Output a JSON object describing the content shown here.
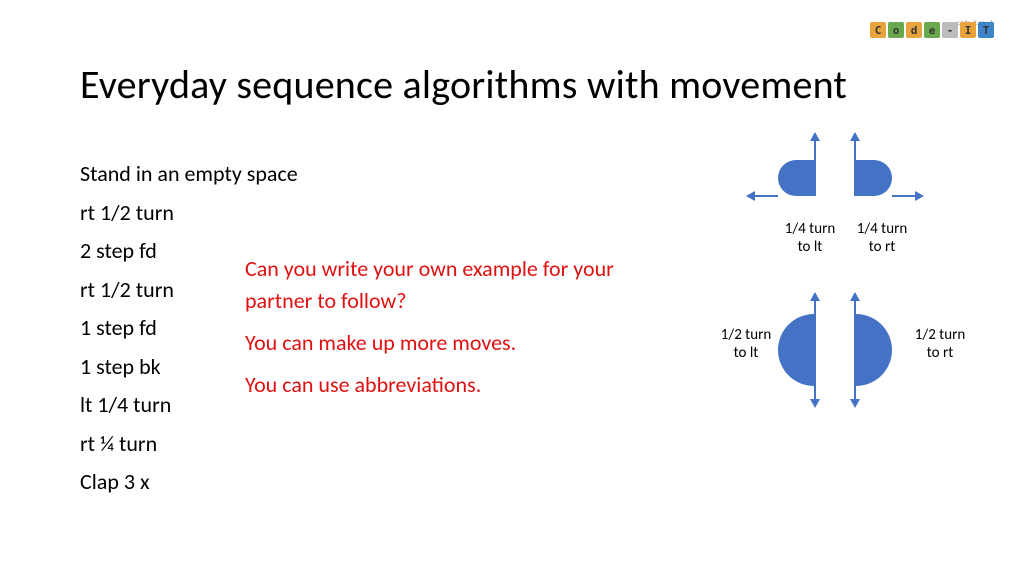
{
  "logo": {
    "text": "Code-IT",
    "tagline": "code-it.co.uk",
    "colors": [
      "#e8a33d",
      "#6aa84f",
      "#e8a33d",
      "#6aa84f",
      "#bbb",
      "#e8a33d",
      "#3d85c6"
    ]
  },
  "title": "Everyday sequence algorithms with movement",
  "steps": [
    "Stand in an empty space",
    "rt 1/2 turn",
    "2 step fd",
    "rt 1/2 turn",
    "1 step fd",
    "1 step bk",
    "lt 1/4 turn",
    "rt ¼ turn",
    "Clap 3 x"
  ],
  "prompt": {
    "line1": "Can you write your own example for your partner to follow?",
    "line2": "You can make up more moves.",
    "line3": "You can use abbreviations."
  },
  "diagram": {
    "q_lt": "1/4 turn to lt",
    "q_rt": "1/4 turn to rt",
    "h_lt": "1/2 turn to lt",
    "h_rt": "1/2 turn to rt"
  }
}
